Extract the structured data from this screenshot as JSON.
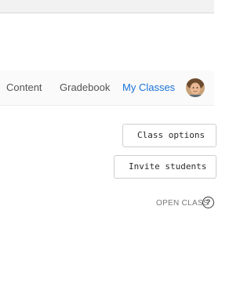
{
  "nav": {
    "items": [
      {
        "label": "Content"
      },
      {
        "label": "Gradebook"
      },
      {
        "label": "My Classes",
        "active": true
      }
    ]
  },
  "actions": {
    "class_options_label": "Class options",
    "invite_students_label": "Invite students",
    "open_class_label": "OPEN CLASS",
    "help_glyph": "?"
  },
  "colors": {
    "accent": "#1a73d9",
    "nav_text": "#555555",
    "nav_background": "#fafafa"
  },
  "icons": {
    "avatar": "user-avatar-icon",
    "help": "help-circle-icon"
  }
}
